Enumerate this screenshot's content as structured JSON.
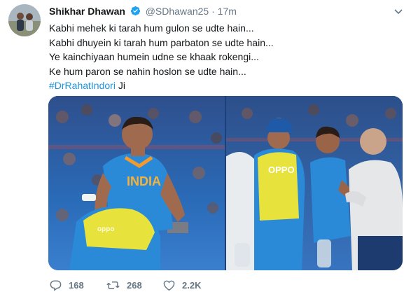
{
  "tweet": {
    "author_name": "Shikhar Dhawan",
    "handle": "@SDhawan25",
    "separator": "·",
    "time": "17m",
    "lines": [
      "Kabhi mehek ki tarah hum gulon se udte hain...",
      "Kabhi dhuyein ki tarah hum parbaton se udte hain...",
      "Ye kainchiyaan humein udne se khaak rokengi...",
      "Ke hum paron se nahin hoslon se udte hain..."
    ],
    "hashtag": "#DrRahatIndori",
    "hashtag_suffix": " Ji",
    "jersey_text_left": "INDIA",
    "jersey_text_left_back": "oppo",
    "jersey_text_right": "OPPO"
  },
  "actions": {
    "replies": "168",
    "retweets": "268",
    "likes": "2.2K"
  },
  "colors": {
    "link": "#1b95e0",
    "muted": "#657786",
    "jersey_blue": "#2a8ad8",
    "bib_yellow": "#e8e23c"
  },
  "icons": [
    "verified-badge-icon",
    "chevron-down-icon",
    "reply-icon",
    "retweet-icon",
    "like-icon"
  ]
}
